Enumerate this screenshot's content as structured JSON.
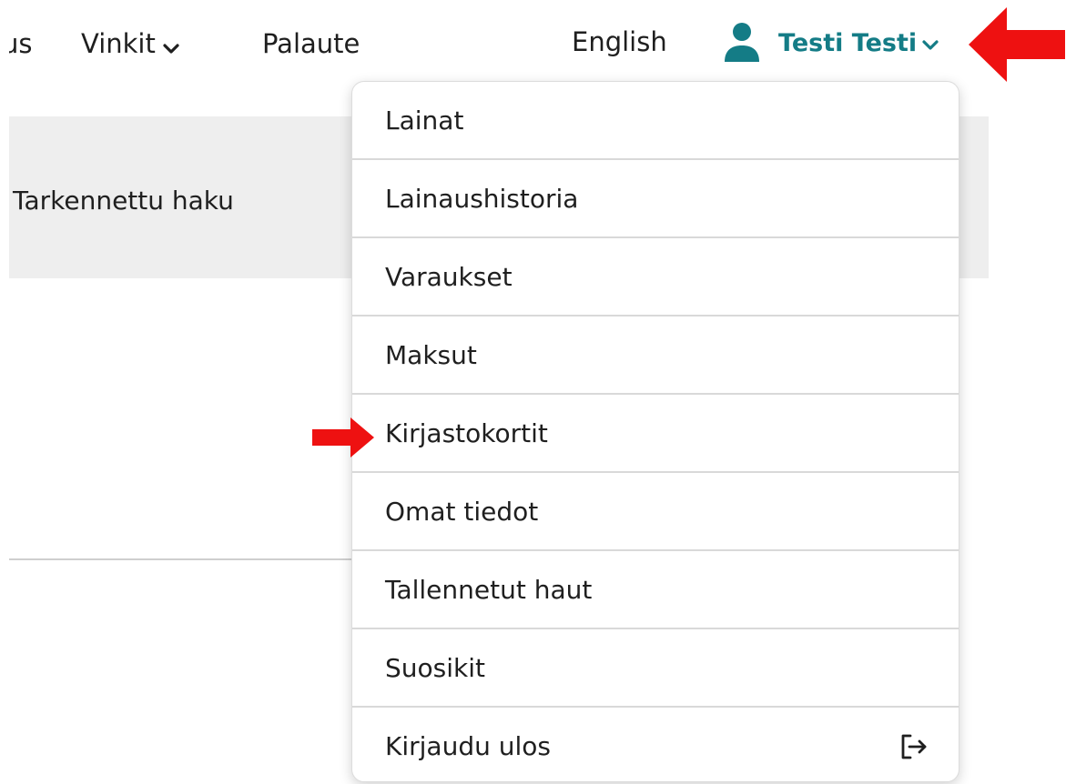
{
  "nav": {
    "partial_label": "us",
    "vinkit_label": "Vinkit",
    "palaute_label": "Palaute",
    "english_label": "English",
    "user_name": "Testi Testi"
  },
  "search": {
    "advanced_label": "Tarkennettu haku"
  },
  "user_dropdown": {
    "items": [
      {
        "label": "Lainat"
      },
      {
        "label": "Lainaushistoria"
      },
      {
        "label": "Varaukset"
      },
      {
        "label": "Maksut"
      },
      {
        "label": "Kirjastokortit"
      },
      {
        "label": "Omat tiedot"
      },
      {
        "label": "Tallennetut haut"
      },
      {
        "label": "Suosikit"
      },
      {
        "label": "Kirjaudu ulos",
        "icon": "logout-icon"
      }
    ]
  },
  "annotations": {
    "arrow_color": "#ee1111"
  },
  "colors": {
    "accent": "#147c86",
    "band": "#eeeeee"
  },
  "icons": {
    "user": "user-icon",
    "chevron": "chevron-down-icon",
    "logout": "logout-icon",
    "arrow": "arrow-left-icon"
  }
}
